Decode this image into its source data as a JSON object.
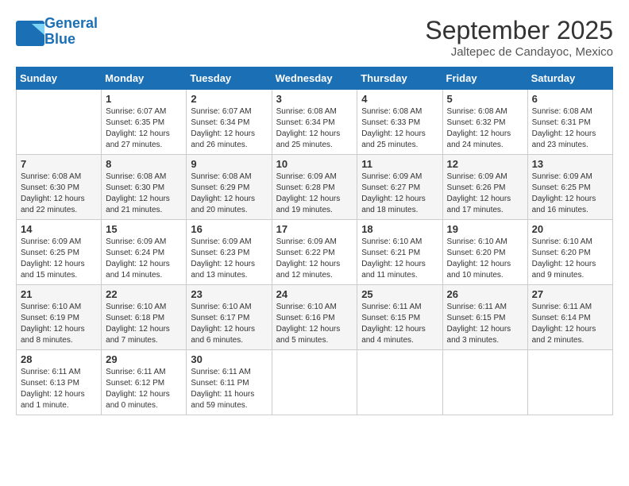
{
  "header": {
    "logo_line1": "General",
    "logo_line2": "Blue",
    "month_title": "September 2025",
    "subtitle": "Jaltepec de Candayoc, Mexico"
  },
  "days_of_week": [
    "Sunday",
    "Monday",
    "Tuesday",
    "Wednesday",
    "Thursday",
    "Friday",
    "Saturday"
  ],
  "weeks": [
    [
      {
        "day": "",
        "info": ""
      },
      {
        "day": "1",
        "info": "Sunrise: 6:07 AM\nSunset: 6:35 PM\nDaylight: 12 hours\nand 27 minutes."
      },
      {
        "day": "2",
        "info": "Sunrise: 6:07 AM\nSunset: 6:34 PM\nDaylight: 12 hours\nand 26 minutes."
      },
      {
        "day": "3",
        "info": "Sunrise: 6:08 AM\nSunset: 6:34 PM\nDaylight: 12 hours\nand 25 minutes."
      },
      {
        "day": "4",
        "info": "Sunrise: 6:08 AM\nSunset: 6:33 PM\nDaylight: 12 hours\nand 25 minutes."
      },
      {
        "day": "5",
        "info": "Sunrise: 6:08 AM\nSunset: 6:32 PM\nDaylight: 12 hours\nand 24 minutes."
      },
      {
        "day": "6",
        "info": "Sunrise: 6:08 AM\nSunset: 6:31 PM\nDaylight: 12 hours\nand 23 minutes."
      }
    ],
    [
      {
        "day": "7",
        "info": "Sunrise: 6:08 AM\nSunset: 6:30 PM\nDaylight: 12 hours\nand 22 minutes."
      },
      {
        "day": "8",
        "info": "Sunrise: 6:08 AM\nSunset: 6:30 PM\nDaylight: 12 hours\nand 21 minutes."
      },
      {
        "day": "9",
        "info": "Sunrise: 6:08 AM\nSunset: 6:29 PM\nDaylight: 12 hours\nand 20 minutes."
      },
      {
        "day": "10",
        "info": "Sunrise: 6:09 AM\nSunset: 6:28 PM\nDaylight: 12 hours\nand 19 minutes."
      },
      {
        "day": "11",
        "info": "Sunrise: 6:09 AM\nSunset: 6:27 PM\nDaylight: 12 hours\nand 18 minutes."
      },
      {
        "day": "12",
        "info": "Sunrise: 6:09 AM\nSunset: 6:26 PM\nDaylight: 12 hours\nand 17 minutes."
      },
      {
        "day": "13",
        "info": "Sunrise: 6:09 AM\nSunset: 6:25 PM\nDaylight: 12 hours\nand 16 minutes."
      }
    ],
    [
      {
        "day": "14",
        "info": "Sunrise: 6:09 AM\nSunset: 6:25 PM\nDaylight: 12 hours\nand 15 minutes."
      },
      {
        "day": "15",
        "info": "Sunrise: 6:09 AM\nSunset: 6:24 PM\nDaylight: 12 hours\nand 14 minutes."
      },
      {
        "day": "16",
        "info": "Sunrise: 6:09 AM\nSunset: 6:23 PM\nDaylight: 12 hours\nand 13 minutes."
      },
      {
        "day": "17",
        "info": "Sunrise: 6:09 AM\nSunset: 6:22 PM\nDaylight: 12 hours\nand 12 minutes."
      },
      {
        "day": "18",
        "info": "Sunrise: 6:10 AM\nSunset: 6:21 PM\nDaylight: 12 hours\nand 11 minutes."
      },
      {
        "day": "19",
        "info": "Sunrise: 6:10 AM\nSunset: 6:20 PM\nDaylight: 12 hours\nand 10 minutes."
      },
      {
        "day": "20",
        "info": "Sunrise: 6:10 AM\nSunset: 6:20 PM\nDaylight: 12 hours\nand 9 minutes."
      }
    ],
    [
      {
        "day": "21",
        "info": "Sunrise: 6:10 AM\nSunset: 6:19 PM\nDaylight: 12 hours\nand 8 minutes."
      },
      {
        "day": "22",
        "info": "Sunrise: 6:10 AM\nSunset: 6:18 PM\nDaylight: 12 hours\nand 7 minutes."
      },
      {
        "day": "23",
        "info": "Sunrise: 6:10 AM\nSunset: 6:17 PM\nDaylight: 12 hours\nand 6 minutes."
      },
      {
        "day": "24",
        "info": "Sunrise: 6:10 AM\nSunset: 6:16 PM\nDaylight: 12 hours\nand 5 minutes."
      },
      {
        "day": "25",
        "info": "Sunrise: 6:11 AM\nSunset: 6:15 PM\nDaylight: 12 hours\nand 4 minutes."
      },
      {
        "day": "26",
        "info": "Sunrise: 6:11 AM\nSunset: 6:15 PM\nDaylight: 12 hours\nand 3 minutes."
      },
      {
        "day": "27",
        "info": "Sunrise: 6:11 AM\nSunset: 6:14 PM\nDaylight: 12 hours\nand 2 minutes."
      }
    ],
    [
      {
        "day": "28",
        "info": "Sunrise: 6:11 AM\nSunset: 6:13 PM\nDaylight: 12 hours\nand 1 minute."
      },
      {
        "day": "29",
        "info": "Sunrise: 6:11 AM\nSunset: 6:12 PM\nDaylight: 12 hours\nand 0 minutes."
      },
      {
        "day": "30",
        "info": "Sunrise: 6:11 AM\nSunset: 6:11 PM\nDaylight: 11 hours\nand 59 minutes."
      },
      {
        "day": "",
        "info": ""
      },
      {
        "day": "",
        "info": ""
      },
      {
        "day": "",
        "info": ""
      },
      {
        "day": "",
        "info": ""
      }
    ]
  ]
}
